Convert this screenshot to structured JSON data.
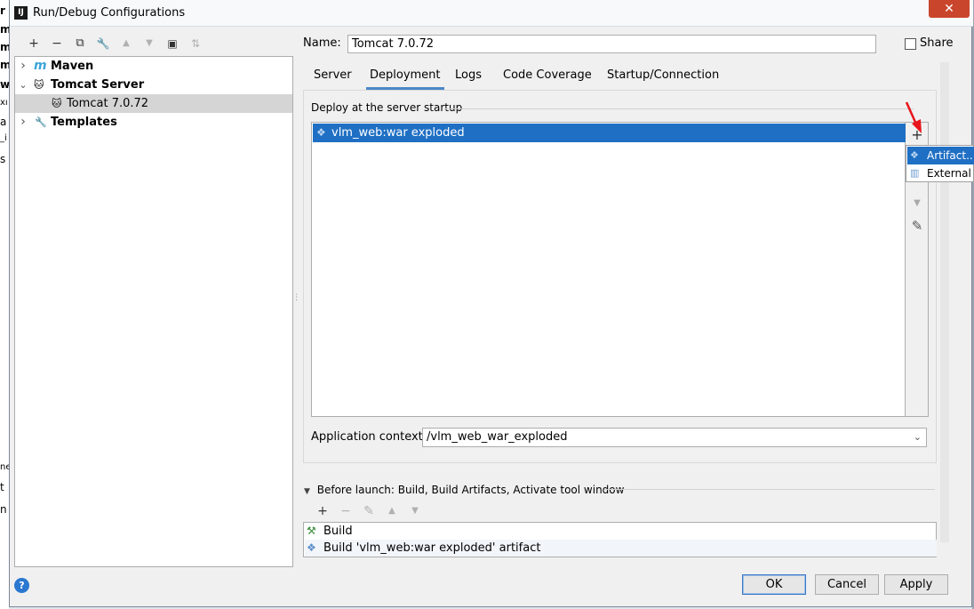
{
  "window": {
    "title": "Run/Debug Configurations",
    "close_glyph": "✕",
    "app_icon": "IJ"
  },
  "background_fragments": [
    "r",
    "m",
    "m",
    "m",
    "w",
    "xı",
    "a",
    "_i",
    "s",
    "ne",
    "t",
    "n"
  ],
  "toolbar": {
    "items": [
      {
        "name": "add-icon",
        "glyph": "+"
      },
      {
        "name": "remove-icon",
        "glyph": "−"
      },
      {
        "name": "copy-icon",
        "glyph": "⧉"
      },
      {
        "name": "wrench-icon",
        "glyph": "🔧"
      },
      {
        "name": "move-up-icon",
        "glyph": "▲"
      },
      {
        "name": "move-down-icon",
        "glyph": "▼"
      },
      {
        "name": "new-folder-icon",
        "glyph": "▣"
      },
      {
        "name": "sort-icon",
        "glyph": "⇅"
      }
    ]
  },
  "tree": {
    "items": [
      {
        "label": "Maven",
        "icon": "maven-icon",
        "glyph": "m",
        "arrow": "›",
        "bold": true
      },
      {
        "label": "Tomcat Server",
        "icon": "tomcat-icon",
        "glyph": "🐱",
        "arrow": "⌄",
        "bold": true
      },
      {
        "label": "Tomcat 7.0.72",
        "icon": "tomcat-icon",
        "glyph": "🐱",
        "arrow": "",
        "bold": false,
        "selected": true
      },
      {
        "label": "Templates",
        "icon": "wrench-icon",
        "glyph": "🔧",
        "arrow": "›",
        "bold": true
      }
    ]
  },
  "form": {
    "name_label": "Name:",
    "name_value": "Tomcat 7.0.72",
    "share_label": "Share"
  },
  "tabs": [
    {
      "label": "Server",
      "active": false
    },
    {
      "label": "Deployment",
      "active": true
    },
    {
      "label": "Logs",
      "active": false
    },
    {
      "label": "Code Coverage",
      "active": false
    },
    {
      "label": "Startup/Connection",
      "active": false
    }
  ],
  "deployment": {
    "section_title": "Deploy at the server startup",
    "artifacts": [
      {
        "label": "vlm_web:war exploded",
        "icon": "artifact-icon",
        "glyph": "❖"
      }
    ],
    "side_tools": [
      {
        "name": "add-artifact-icon",
        "glyph": "+"
      },
      {
        "name": "move-down-icon",
        "glyph": "▼"
      },
      {
        "name": "edit-icon",
        "glyph": "✎"
      }
    ],
    "popup": [
      {
        "label": "Artifact...",
        "icon": "artifact-icon",
        "glyph": "❖",
        "selected": true
      },
      {
        "label": "External Source...",
        "icon": "external-source-icon",
        "glyph": "▥",
        "selected": false
      }
    ],
    "context_label": "Application context:",
    "context_value": "/vlm_web_war_exploded",
    "context_chevron": "⌄"
  },
  "before_launch": {
    "title": "Before launch: Build, Build Artifacts, Activate tool window",
    "collapse_glyph": "▼",
    "tools": [
      {
        "name": "add-icon",
        "glyph": "+",
        "enabled": true
      },
      {
        "name": "remove-icon",
        "glyph": "−",
        "enabled": false
      },
      {
        "name": "edit-icon",
        "glyph": "✎",
        "enabled": false
      },
      {
        "name": "move-up-icon",
        "glyph": "▲",
        "enabled": false
      },
      {
        "name": "move-down-icon",
        "glyph": "▼",
        "enabled": false
      }
    ],
    "tasks": [
      {
        "label": "Build",
        "icon": "build-hammer-icon",
        "glyph": "⚒"
      },
      {
        "label": "Build 'vlm_web:war exploded' artifact",
        "icon": "artifact-icon",
        "glyph": "❖"
      }
    ]
  },
  "footer": {
    "help_glyph": "?",
    "ok_label": "OK",
    "cancel_label": "Cancel",
    "apply_label": "Apply"
  },
  "colors": {
    "selection_blue": "#1f6fc4",
    "tab_underline": "#4a88c7",
    "annotation_red": "#e8141c",
    "close_red": "#c9462c"
  }
}
